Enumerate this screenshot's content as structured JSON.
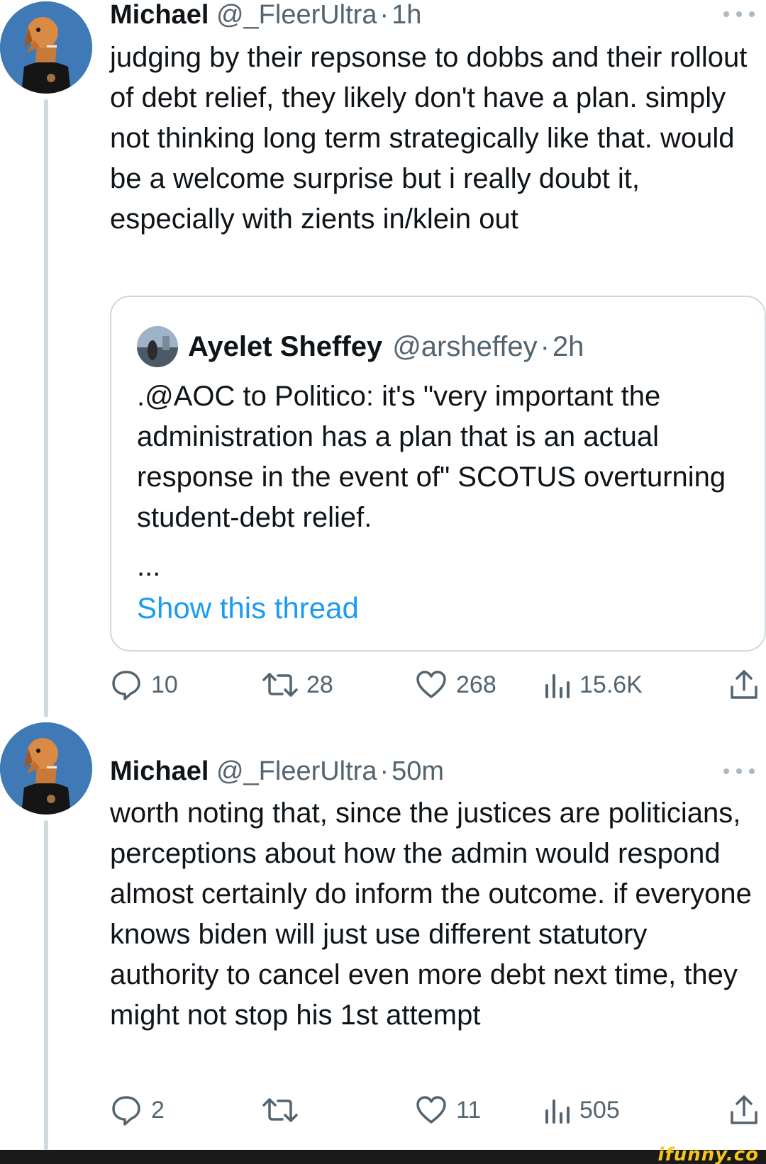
{
  "tweets": [
    {
      "name": "Michael",
      "handle": "@_FleerUltra",
      "separator": "·",
      "time": "1h",
      "text": "judging by their repsonse to dobbs and their rollout of debt relief, they likely don't have a plan. simply not thinking long term strategically like that. would be a welcome surprise but i really doubt it, especially with zients in/klein out",
      "quote": {
        "name": "Ayelet Sheffey",
        "handle": "@arsheffey",
        "separator": "·",
        "time": "2h",
        "text": ".@AOC to Politico: it's \"very important the administration has a plan that is an actual response in the event of\" SCOTUS overturning student-debt relief.",
        "ellipsis": "...",
        "show_thread": "Show this thread"
      },
      "actions": {
        "replies": "10",
        "retweets": "28",
        "likes": "268",
        "views": "15.6K"
      }
    },
    {
      "name": "Michael",
      "handle": "@_FleerUltra",
      "separator": "·",
      "time": "50m",
      "text": "worth noting that, since the justices are politicians, perceptions about how the admin would respond almost certainly do inform the outcome. if everyone knows biden will just use different statutory authority to cancel even more debt next time, they might not stop his 1st attempt",
      "actions": {
        "replies": "2",
        "retweets": "",
        "likes": "11",
        "views": "505"
      }
    }
  ],
  "icons": {
    "reply": "reply-icon",
    "retweet": "retweet-icon",
    "like": "heart-icon",
    "views": "views-icon",
    "share": "share-icon",
    "more": "more-icon"
  },
  "colors": {
    "link": "#1d9bf0",
    "muted": "#536471",
    "text": "#0f1419",
    "border": "#cfd9de",
    "avatar_bg": "#3f7ab6"
  },
  "watermark": "ifunny.co"
}
